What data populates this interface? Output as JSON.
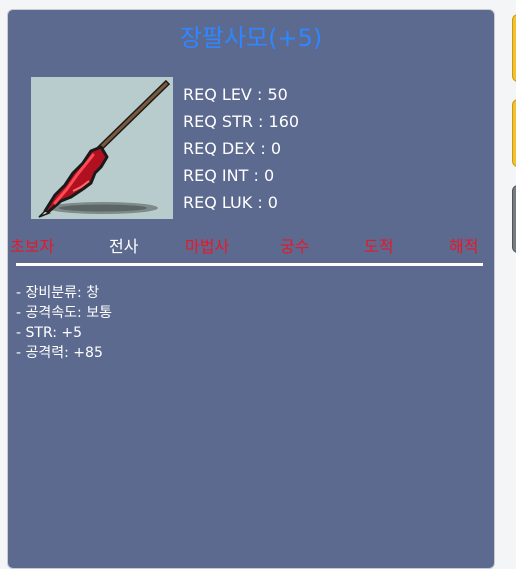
{
  "item": {
    "name": "장팔사모(+5)",
    "icon": "spear-icon"
  },
  "requirements": [
    {
      "label": "REQ LEV",
      "value": "50"
    },
    {
      "label": "REQ STR",
      "value": "160"
    },
    {
      "label": "REQ DEX",
      "value": "0"
    },
    {
      "label": "REQ INT",
      "value": "0"
    },
    {
      "label": "REQ LUK",
      "value": "0"
    }
  ],
  "jobs": [
    {
      "name": "초보자",
      "eligible": false
    },
    {
      "name": "전사",
      "eligible": true
    },
    {
      "name": "마법사",
      "eligible": false
    },
    {
      "name": "궁수",
      "eligible": false
    },
    {
      "name": "도적",
      "eligible": false
    },
    {
      "name": "해적",
      "eligible": false
    }
  ],
  "stats": [
    "- 장비분류: 창",
    "- 공격속도: 보통",
    "- STR: +5",
    "- 공격력: +85"
  ],
  "colors": {
    "panel": "#5c6a8f",
    "title": "#2f86ff",
    "eligible": "#ffffff",
    "ineligible": "#e8172a",
    "icon_bg": "#b8cccd"
  }
}
